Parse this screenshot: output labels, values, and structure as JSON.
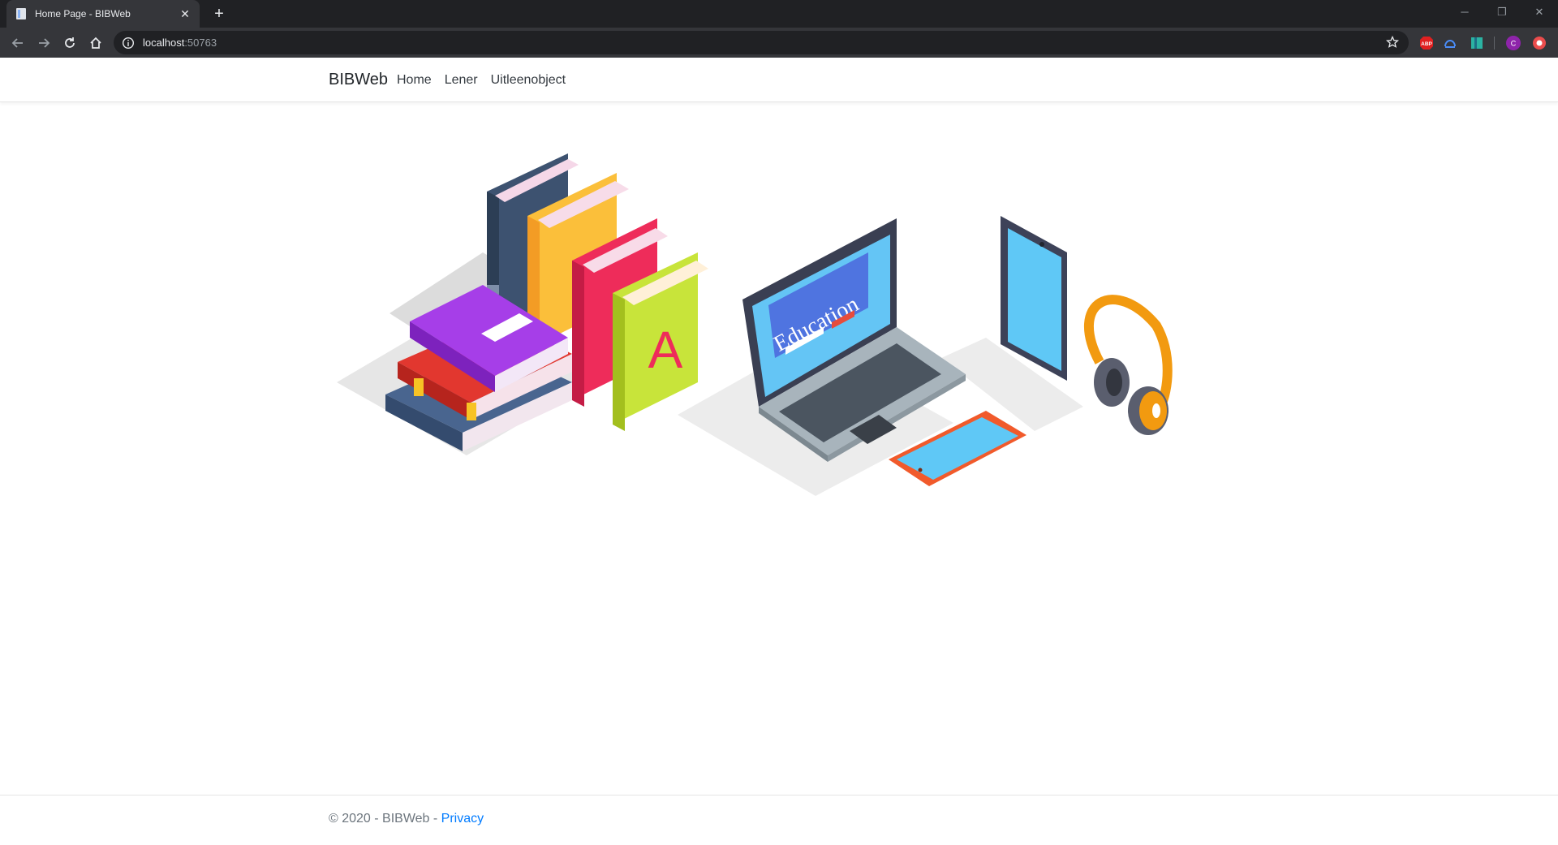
{
  "browser": {
    "tab_title": "Home Page - BIBWeb",
    "tab_close": "✕",
    "new_tab": "+",
    "url_host": "localhost",
    "url_port": ":50763",
    "window_controls": {
      "minimize": "─",
      "restore": "❐",
      "close": "✕"
    },
    "extensions": [
      {
        "name": "adblock-plus-icon",
        "label": "ABP",
        "color": "#e02020"
      },
      {
        "name": "extension-icon",
        "color": "#4a8df8"
      },
      {
        "name": "extension-icon-2",
        "color": "#2bb3a3"
      },
      {
        "name": "profile-avatar",
        "label": "C",
        "color": "#8e24aa"
      },
      {
        "name": "extension-icon-3",
        "color": "#ea4c4c"
      }
    ]
  },
  "navbar": {
    "brand": "BIBWeb",
    "links": [
      "Home",
      "Lener",
      "Uitleenobject"
    ]
  },
  "hero": {
    "screen_text": "Education",
    "book_letter": "A"
  },
  "footer": {
    "copyright": "© 2020 - BIBWeb - ",
    "privacy": "Privacy"
  },
  "colors": {
    "chrome_dark": "#202124",
    "chrome_mid": "#35363a",
    "link_blue": "#007bff",
    "text_dark": "#212529"
  }
}
